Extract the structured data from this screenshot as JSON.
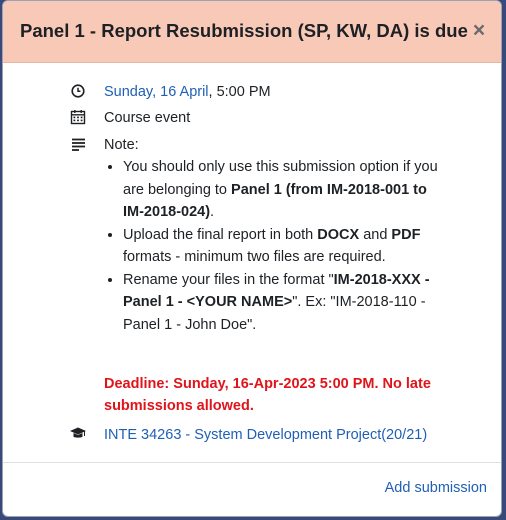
{
  "modal": {
    "title": "Panel 1 - Report Resubmission (SP, KW, DA) is due",
    "close_glyph": "×"
  },
  "event": {
    "date_link": "Sunday, 16 April",
    "time": ", 5:00 PM",
    "event_type": "Course event",
    "note_label": "Note:",
    "bullets": [
      {
        "pre": "You should only use this submission option if you are belonging to ",
        "bold": "Panel 1 (from IM-2018-001 to IM-2018-024)",
        "post": "."
      },
      {
        "pre": "Upload the final report in both ",
        "bold1": "DOCX",
        "mid": " and ",
        "bold2": "PDF",
        "post": " formats - minimum two files are required."
      },
      {
        "pre": "Rename your files in the format \"",
        "bold": "IM-2018-XXX - Panel 1 - <YOUR NAME>",
        "post": "\". Ex: \"IM-2018-110 - Panel 1 - John Doe\"."
      }
    ],
    "deadline": "Deadline: Sunday, 16-Apr-2023 5:00 PM. No late submissions allowed.",
    "course_link": "INTE 34263 - System Development Project(20/21)"
  },
  "footer": {
    "add_submission": "Add submission"
  },
  "icons": {
    "time": "clock-icon",
    "event": "calendar-icon",
    "description": "align-left-icon",
    "course": "graduation-cap-icon"
  },
  "colors": {
    "header_bg": "#f9c9b8",
    "link": "#1f5fb5",
    "deadline": "#e0141b"
  }
}
